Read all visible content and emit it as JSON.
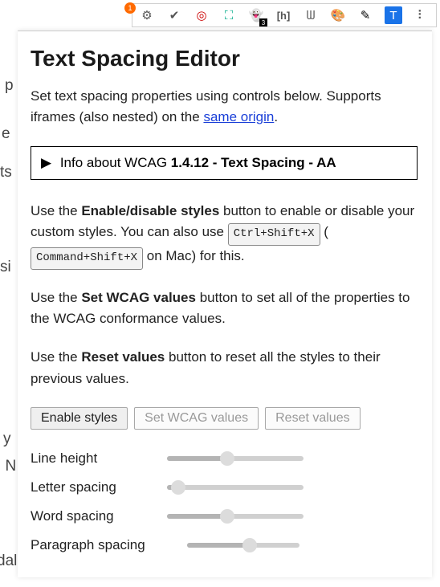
{
  "toolbar": {
    "icons": [
      {
        "name": "gear-icon",
        "glyph": "⚙"
      },
      {
        "name": "check-icon",
        "glyph": "✔"
      },
      {
        "name": "target-icon",
        "glyph": "◎"
      },
      {
        "name": "frame-icon",
        "glyph": "⛶"
      },
      {
        "name": "ghost-icon",
        "glyph": "👻",
        "badge": "3"
      },
      {
        "name": "heading-icon",
        "glyph": "[h]"
      },
      {
        "name": "wave-icon",
        "glyph": "ᗯ"
      },
      {
        "name": "palette-icon",
        "glyph": "🎨"
      },
      {
        "name": "eyedropper-icon",
        "glyph": "✎"
      },
      {
        "name": "text-spacing-icon",
        "glyph": "T",
        "active": true
      },
      {
        "name": "extensions-icon",
        "glyph": "⠇"
      }
    ],
    "badge_count": "1"
  },
  "panel": {
    "title": "Text Spacing Editor",
    "description_prefix": "Set text spacing properties using controls below. Supports iframes (also nested) on the ",
    "description_link": "same origin",
    "description_suffix": ".",
    "info": {
      "prefix": "Info about WCAG ",
      "bold": "1.4.12 - Text Spacing - AA"
    },
    "para1_prefix": "Use the ",
    "para1_bold": "Enable/disable styles",
    "para1_rest": " button to enable or disable your custom styles. You can also use ",
    "kbd1": "Ctrl+Shift+X",
    "para1_paren_open": " (",
    "kbd2": "Command+Shift+X",
    "para1_paren_close": " on Mac) for this.",
    "para2_prefix": "Use the ",
    "para2_bold": "Set WCAG values",
    "para2_rest": " button to set all of the properties to the WCAG conformance values.",
    "para3_prefix": "Use the ",
    "para3_bold": "Reset values",
    "para3_rest": " button to reset all the styles to their previous values.",
    "buttons": {
      "enable": "Enable styles",
      "wcag": "Set WCAG values",
      "reset": "Reset values"
    },
    "sliders": [
      {
        "label": "Line height",
        "pct": 44
      },
      {
        "label": "Letter spacing",
        "pct": 8
      },
      {
        "label": "Word spacing",
        "pct": 44
      },
      {
        "label": "Paragraph spacing",
        "pct": 56
      }
    ]
  },
  "behind": {
    "frag1": "p",
    "frag2": "e",
    "frag3": "ts",
    "frag4": "si",
    "frag5": "y",
    "frag6": ". N",
    "frag7": "dal"
  }
}
